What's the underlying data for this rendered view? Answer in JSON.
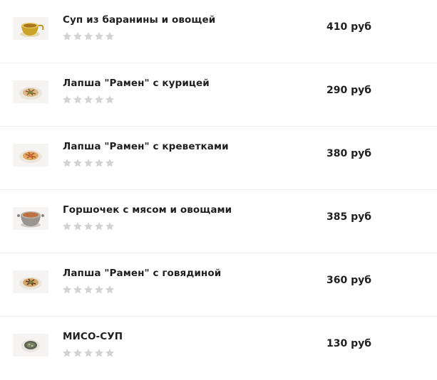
{
  "menu": {
    "items": [
      {
        "name": "Суп из баранины и овощей",
        "price": "410 руб",
        "rating": 0,
        "thumb_icon": "soup-tureen-icon"
      },
      {
        "name": "Лапша \"Рамен\" с курицей",
        "price": "290 руб",
        "rating": 0,
        "thumb_icon": "ramen-bowl-icon"
      },
      {
        "name": "Лапша \"Рамен\" с креветками",
        "price": "380 руб",
        "rating": 0,
        "thumb_icon": "ramen-bowl-icon"
      },
      {
        "name": "Горшочек с мясом и овощами",
        "price": "385 руб",
        "rating": 0,
        "thumb_icon": "clay-pot-icon"
      },
      {
        "name": "Лапша \"Рамен\" с говядиной",
        "price": "360 руб",
        "rating": 0,
        "thumb_icon": "ramen-bowl-icon"
      },
      {
        "name": "МИСО-СУП",
        "price": "130 руб",
        "rating": 0,
        "thumb_icon": "miso-bowl-icon"
      }
    ],
    "rating_max": 5,
    "colors": {
      "star_empty": "#d3d3d3",
      "text": "#1f1f1f",
      "divider": "#efefef"
    }
  }
}
